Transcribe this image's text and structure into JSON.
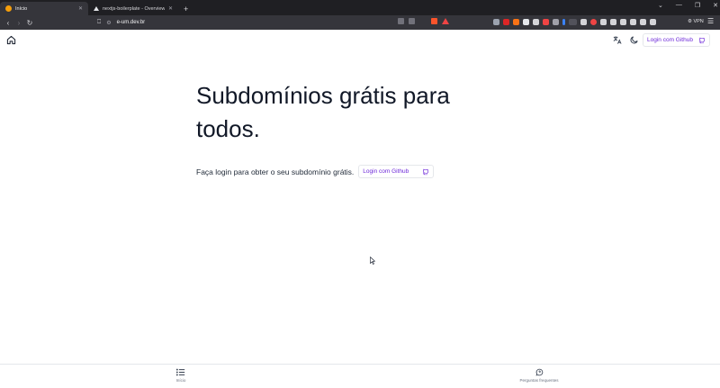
{
  "browser": {
    "tabs": [
      {
        "title": "Início",
        "active": true
      },
      {
        "title": "nextjs-boilerplate - Overview – Vercel",
        "active": false
      }
    ],
    "new_tab": "+",
    "url": "e-um.dev.br",
    "vpn_label": "VPN",
    "window_controls": [
      "⌄",
      "—",
      "❐",
      "✕"
    ]
  },
  "header": {
    "login_label": "Login com Github"
  },
  "hero": {
    "title": "Subdomínios grátis para todos.",
    "subtitle": "Faça login para obter o seu subdomínio grátis.",
    "login_label": "Login com Github"
  },
  "bottom_nav": {
    "items": [
      {
        "label": "Início",
        "icon": "list-icon"
      },
      {
        "label": "Perguntas frequentes",
        "icon": "chat-question-icon"
      }
    ]
  },
  "colors": {
    "accent": "#6d28d9",
    "chrome_dark": "#1f1f23",
    "chrome_toolbar": "#35353b"
  }
}
